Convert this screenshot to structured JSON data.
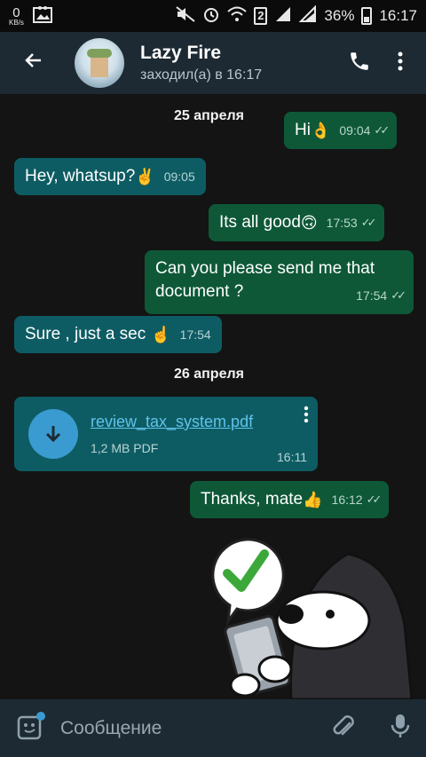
{
  "statusbar": {
    "speed_value": "0",
    "speed_unit": "KB/s",
    "sim_badge": "2",
    "battery": "36%",
    "time": "16:17"
  },
  "header": {
    "contact_name": "Lazy Fire",
    "last_seen": "заходил(а) в 16:17"
  },
  "chat": {
    "dates": [
      "25 апреля",
      "26 апреля"
    ],
    "messages": [
      {
        "dir": "out",
        "text": "Hi",
        "emoji": "👌",
        "time": "09:04",
        "read": true
      },
      {
        "dir": "in",
        "text": "Hey, whatsup?",
        "emoji": "✌️",
        "time": "09:05"
      },
      {
        "dir": "out",
        "text": "Its all good",
        "emoji": "🙃",
        "time": "17:53",
        "read": true
      },
      {
        "dir": "out",
        "text": "Can you please send me that document ?",
        "emoji": "",
        "time": "17:54",
        "read": true
      },
      {
        "dir": "in",
        "text": "Sure , just a sec",
        "emoji": "☝️",
        "time": "17:54"
      },
      {
        "dir": "out",
        "text": "Thanks, mate",
        "emoji": "👍",
        "time": "16:12",
        "read": true
      }
    ],
    "file": {
      "name": "review_tax_system.pdf",
      "meta": "1,2 MB PDF",
      "time": "16:11"
    }
  },
  "input": {
    "placeholder": "Сообщение"
  },
  "colors": {
    "header_bg": "#1d2a33",
    "outgoing_bubble": "#0e5838",
    "incoming_bubble": "#0e5c63",
    "link": "#5fc3ec",
    "download_circle": "#3a9bd0"
  }
}
